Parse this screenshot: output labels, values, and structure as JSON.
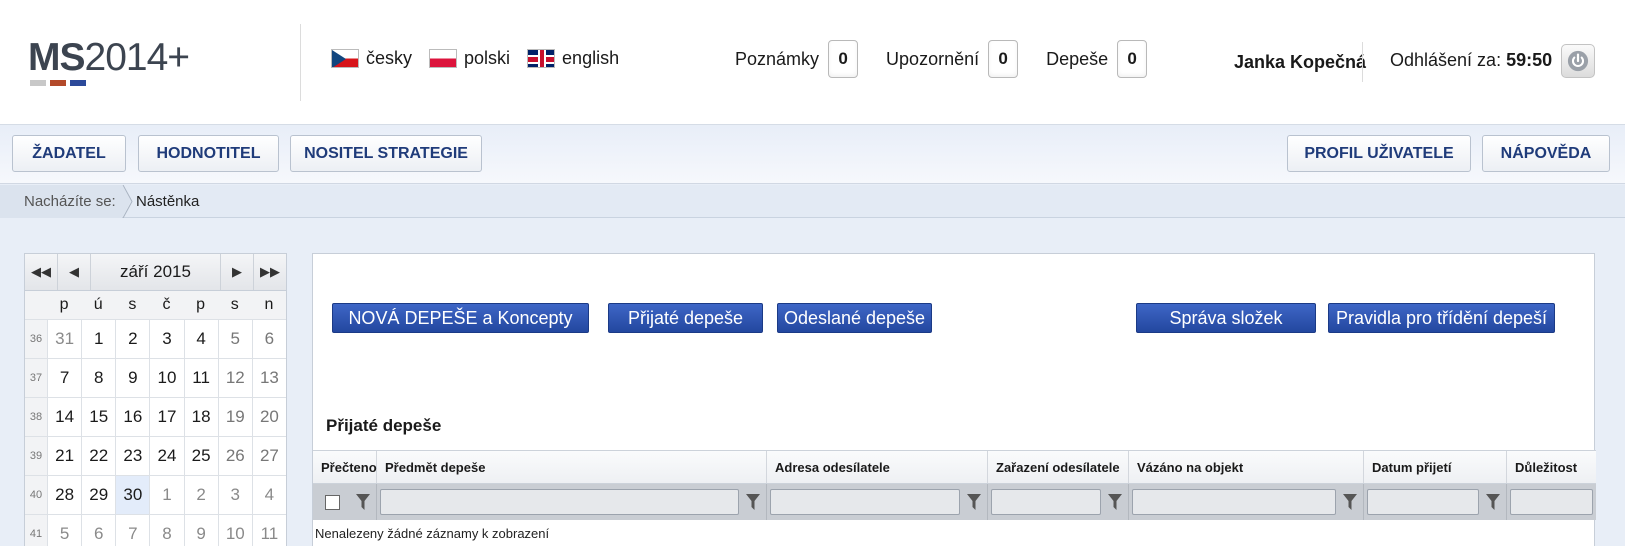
{
  "logo": {
    "bold": "MS",
    "rest": "2014+"
  },
  "languages": [
    {
      "label": "česky",
      "flag": "cz"
    },
    {
      "label": "polski",
      "flag": "pl"
    },
    {
      "label": "english",
      "flag": "uk"
    }
  ],
  "counters": [
    {
      "label": "Poznámky",
      "value": "0"
    },
    {
      "label": "Upozornění",
      "value": "0"
    },
    {
      "label": "Depeše",
      "value": "0"
    }
  ],
  "user": {
    "name": "Janka Kopečná",
    "logout_label": "Odhlášení za:",
    "logout_timer": "59:50"
  },
  "nav": {
    "left": [
      "ŽADATEL",
      "HODNOTITEL",
      "NOSITEL STRATEGIE"
    ],
    "right": [
      "PROFIL UŽIVATELE",
      "NÁPOVĚDA"
    ]
  },
  "breadcrumb": {
    "where_label": "Nacházíte se:",
    "current": "Nástěnka"
  },
  "calendar": {
    "title": "září 2015",
    "weekdays": [
      "p",
      "ú",
      "s",
      "č",
      "p",
      "s",
      "n"
    ],
    "weeks": [
      {
        "num": "36",
        "days": [
          "31",
          "1",
          "2",
          "3",
          "4",
          "5",
          "6"
        ]
      },
      {
        "num": "37",
        "days": [
          "7",
          "8",
          "9",
          "10",
          "11",
          "12",
          "13"
        ]
      },
      {
        "num": "38",
        "days": [
          "14",
          "15",
          "16",
          "17",
          "18",
          "19",
          "20"
        ]
      },
      {
        "num": "39",
        "days": [
          "21",
          "22",
          "23",
          "24",
          "25",
          "26",
          "27"
        ]
      },
      {
        "num": "40",
        "days": [
          "28",
          "29",
          "30",
          "1",
          "2",
          "3",
          "4"
        ]
      },
      {
        "num": "41",
        "days": [
          "5",
          "6",
          "7",
          "8",
          "9",
          "10",
          "11"
        ]
      }
    ],
    "today": "30"
  },
  "actions": [
    "NOVÁ DEPEŠE a Koncepty",
    "Přijaté depeše",
    "Odeslané depeše",
    "Správa složek",
    "Pravidla pro třídění depeší"
  ],
  "section_title": "Přijaté depeše",
  "table": {
    "columns": [
      "Přečteno",
      "Předmět depeše",
      "Adresa odesílatele",
      "Zařazení odesílatele",
      "Vázáno na objekt",
      "Datum přijetí",
      "Důležitost"
    ],
    "empty_message": "Nenalezeny žádné záznamy k zobrazení"
  },
  "colors": {
    "accent": "#2a4fa8",
    "nav_text": "#1f3b7a"
  }
}
